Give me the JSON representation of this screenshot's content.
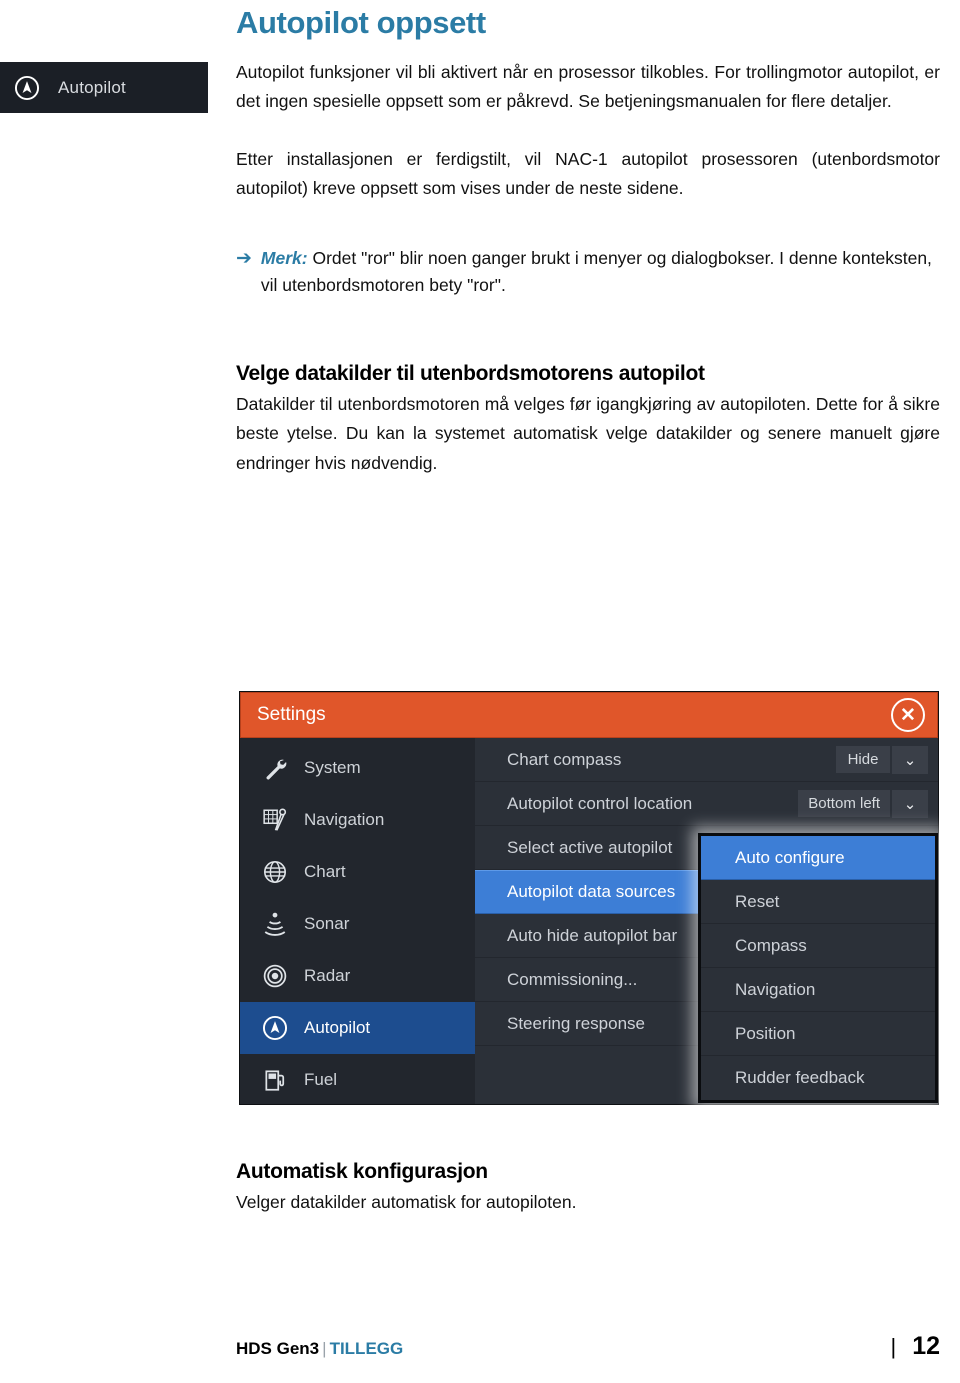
{
  "margin_badge": {
    "label": "Autopilot",
    "icon": "autopilot-icon"
  },
  "document": {
    "title": "Autopilot oppsett",
    "intro_paragraph": "Autopilot funksjoner vil bli aktivert når en prosessor tilkobles. For trollingmotor autopilot, er det ingen spesielle oppsett som er påkrevd. Se betjeningsmanualen for flere detaljer.",
    "second_paragraph": "Etter installasjonen er ferdigstilt, vil NAC-1 autopilot prosessoren (utenbordsmotor autopilot) kreve oppsett som vises under de neste sidene.",
    "note": {
      "arrow": "➔",
      "lead": "Merk:",
      "text": " Ordet \"ror\" blir noen ganger brukt i menyer og dialogbokser. I denne konteksten, vil utenbordsmotoren bety \"ror\"."
    },
    "section_heading": "Velge datakilder til utenbordsmotorens autopilot",
    "section_paragraph": "Datakilder til utenbordsmotoren må velges før igangkjøring av autopiloten. Dette for å sikre beste ytelse. Du kan la systemet automatisk velge datakilder og senere manuelt gjøre endringer hvis nødvendig.",
    "subsection_heading": "Automatisk konfigurasjon",
    "subsection_paragraph": "Velger datakilder automatisk for autopiloten."
  },
  "device": {
    "titlebar": {
      "title": "Settings",
      "close_icon": "close-icon",
      "close_glyph": "✕"
    },
    "sidebar": [
      {
        "label": "System",
        "icon": "wrench-icon",
        "selected": false
      },
      {
        "label": "Navigation",
        "icon": "navigation-icon",
        "selected": false
      },
      {
        "label": "Chart",
        "icon": "globe-icon",
        "selected": false
      },
      {
        "label": "Sonar",
        "icon": "sonar-icon",
        "selected": false
      },
      {
        "label": "Radar",
        "icon": "radar-icon",
        "selected": false
      },
      {
        "label": "Autopilot",
        "icon": "autopilot-icon",
        "selected": true
      },
      {
        "label": "Fuel",
        "icon": "fuel-icon",
        "selected": false
      }
    ],
    "options": [
      {
        "label": "Chart compass",
        "value": "Hide",
        "has_dropdown": true,
        "selected": false
      },
      {
        "label": "Autopilot control location",
        "value": "Bottom left",
        "has_dropdown": true,
        "selected": false
      },
      {
        "label": "Select active autopilot",
        "value": "",
        "has_dropdown": false,
        "selected": false
      },
      {
        "label": "Autopilot data sources",
        "value": "",
        "has_dropdown": false,
        "selected": true
      },
      {
        "label": "Auto hide autopilot bar",
        "value": "",
        "has_dropdown": false,
        "selected": false
      },
      {
        "label": "Commissioning...",
        "value": "",
        "has_dropdown": false,
        "selected": false
      },
      {
        "label": "Steering response",
        "value": "",
        "has_dropdown": false,
        "selected": false
      }
    ],
    "popup": [
      {
        "label": "Auto configure",
        "selected": true
      },
      {
        "label": "Reset",
        "selected": false
      },
      {
        "label": "Compass",
        "selected": false
      },
      {
        "label": "Navigation",
        "selected": false
      },
      {
        "label": "Position",
        "selected": false
      },
      {
        "label": "Rudder feedback",
        "selected": false
      }
    ],
    "caret_glyph": "⌄"
  },
  "footer": {
    "product": "HDS Gen3",
    "separator": "|",
    "brand": "TILLEGG",
    "rule": "|",
    "page_number": "12"
  },
  "colors": {
    "accent_blue": "#2b7ca5",
    "device_orange": "#e0562a",
    "selection_blue": "#3d7ed6",
    "sidebar_selection_blue": "#1d4d8f",
    "device_bg": "#2b3038",
    "device_sidebar_bg": "#22262d",
    "badge_bg": "#1b1f26"
  }
}
